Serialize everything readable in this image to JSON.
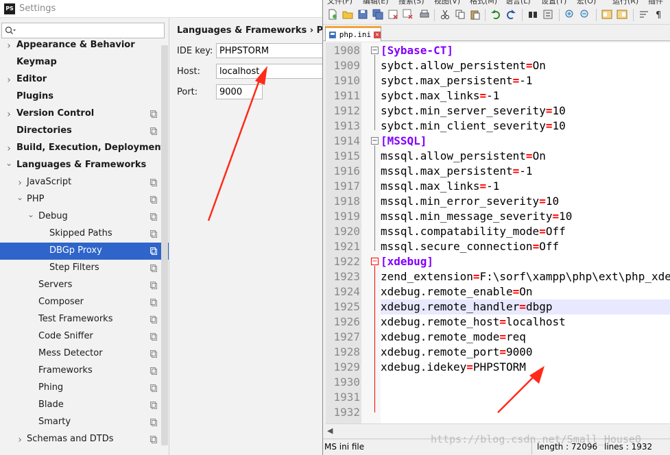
{
  "settings": {
    "window_title": "Settings",
    "logo_text": "PS",
    "search_placeholder": "",
    "tree": [
      {
        "label": "Appearance & Behavior",
        "level": 0,
        "expandable": true,
        "bold": true
      },
      {
        "label": "Keymap",
        "level": 0,
        "expandable": false,
        "bold": true
      },
      {
        "label": "Editor",
        "level": 0,
        "expandable": true,
        "bold": true
      },
      {
        "label": "Plugins",
        "level": 0,
        "expandable": false,
        "bold": true
      },
      {
        "label": "Version Control",
        "level": 0,
        "expandable": true,
        "bold": true,
        "project": true
      },
      {
        "label": "Directories",
        "level": 0,
        "expandable": false,
        "bold": true,
        "project": true
      },
      {
        "label": "Build, Execution, Deployment",
        "level": 0,
        "expandable": true,
        "bold": true
      },
      {
        "label": "Languages & Frameworks",
        "level": 0,
        "expandable": true,
        "expanded": true,
        "bold": true
      },
      {
        "label": "JavaScript",
        "level": 1,
        "expandable": true,
        "project": true
      },
      {
        "label": "PHP",
        "level": 1,
        "expandable": true,
        "expanded": true,
        "project": true
      },
      {
        "label": "Debug",
        "level": 2,
        "expandable": true,
        "expanded": true,
        "project": true
      },
      {
        "label": "Skipped Paths",
        "level": 3,
        "project": true
      },
      {
        "label": "DBGp Proxy",
        "level": 3,
        "project": true,
        "selected": true
      },
      {
        "label": "Step Filters",
        "level": 3,
        "project": true
      },
      {
        "label": "Servers",
        "level": 2,
        "project": true
      },
      {
        "label": "Composer",
        "level": 2,
        "project": true
      },
      {
        "label": "Test Frameworks",
        "level": 2,
        "project": true
      },
      {
        "label": "Code Sniffer",
        "level": 2,
        "project": true
      },
      {
        "label": "Mess Detector",
        "level": 2,
        "project": true
      },
      {
        "label": "Frameworks",
        "level": 2,
        "project": true
      },
      {
        "label": "Phing",
        "level": 2,
        "project": true
      },
      {
        "label": "Blade",
        "level": 2,
        "project": true
      },
      {
        "label": "Smarty",
        "level": 2,
        "project": true
      },
      {
        "label": "Schemas and DTDs",
        "level": 1,
        "expandable": true,
        "project": true
      }
    ],
    "breadcrumb": "Languages & Frameworks  ›  PHP",
    "form": {
      "ide_key_label": "IDE key:",
      "ide_key_value": "PHPSTORM",
      "host_label": "Host:",
      "host_value": "localhost",
      "port_label": "Port:",
      "port_value": "9000"
    }
  },
  "npp": {
    "menu": [
      "文件(F)",
      "编辑(E)",
      "搜索(S)",
      "视图(V)",
      "格式(M)",
      "语言(L)",
      "设置(T)",
      "宏(O)",
      "运行(R)",
      "插件"
    ],
    "tab_label": "php.ini",
    "lines": [
      {
        "n": "1908",
        "key": "[Sybase-CT]",
        "section": true
      },
      {
        "n": "1909",
        "key": "sybct.allow_persistent",
        "val": "On"
      },
      {
        "n": "1910",
        "key": "sybct.max_persistent",
        "val": "-1"
      },
      {
        "n": "1911",
        "key": "sybct.max_links",
        "val": "-1"
      },
      {
        "n": "1912",
        "key": "sybct.min_server_severity",
        "val": "10"
      },
      {
        "n": "1913",
        "key": "sybct.min_client_severity",
        "val": "10"
      },
      {
        "n": "1914",
        "key": "[MSSQL]",
        "section": true
      },
      {
        "n": "1915",
        "key": "mssql.allow_persistent",
        "val": "On"
      },
      {
        "n": "1916",
        "key": "mssql.max_persistent",
        "val": "-1"
      },
      {
        "n": "1917",
        "key": "mssql.max_links",
        "val": "-1"
      },
      {
        "n": "1918",
        "key": "mssql.min_error_severity",
        "val": "10"
      },
      {
        "n": "1919",
        "key": "mssql.min_message_severity",
        "val": "10"
      },
      {
        "n": "1920",
        "key": "mssql.compatability_mode",
        "val": "Off"
      },
      {
        "n": "1921",
        "key": "mssql.secure_connection",
        "val": "Off"
      },
      {
        "n": "1922",
        "key": "[xdebug]",
        "section": true
      },
      {
        "n": "1923",
        "key": "zend_extension",
        "val": "F:\\sorf\\xampp\\php\\ext\\php_xdebug.dll"
      },
      {
        "n": "1924",
        "key": "xdebug.remote_enable",
        "val": "On"
      },
      {
        "n": "1925",
        "key": "xdebug.remote_handler",
        "val": "dbgp",
        "highlight": true
      },
      {
        "n": "1926",
        "key": "xdebug.remote_host",
        "val": "localhost"
      },
      {
        "n": "1927",
        "key": "xdebug.remote_mode",
        "val": "req"
      },
      {
        "n": "1928",
        "key": "xdebug.remote_port",
        "val": "9000"
      },
      {
        "n": "1929",
        "key": "xdebug.idekey",
        "val": "PHPSTORM"
      },
      {
        "n": "1930",
        "key": ""
      },
      {
        "n": "1931",
        "key": ""
      },
      {
        "n": "1932",
        "key": ""
      }
    ],
    "status": {
      "file_type": "MS ini file",
      "length": "length : 72096",
      "lines": "lines : 1932"
    }
  },
  "watermark": "https://blog.csdn.net/Small_House0",
  "colors": {
    "selection": "#2f65ca",
    "arrow": "#ff2a1a",
    "section": "#8000ff",
    "operator": "#ff0000"
  }
}
